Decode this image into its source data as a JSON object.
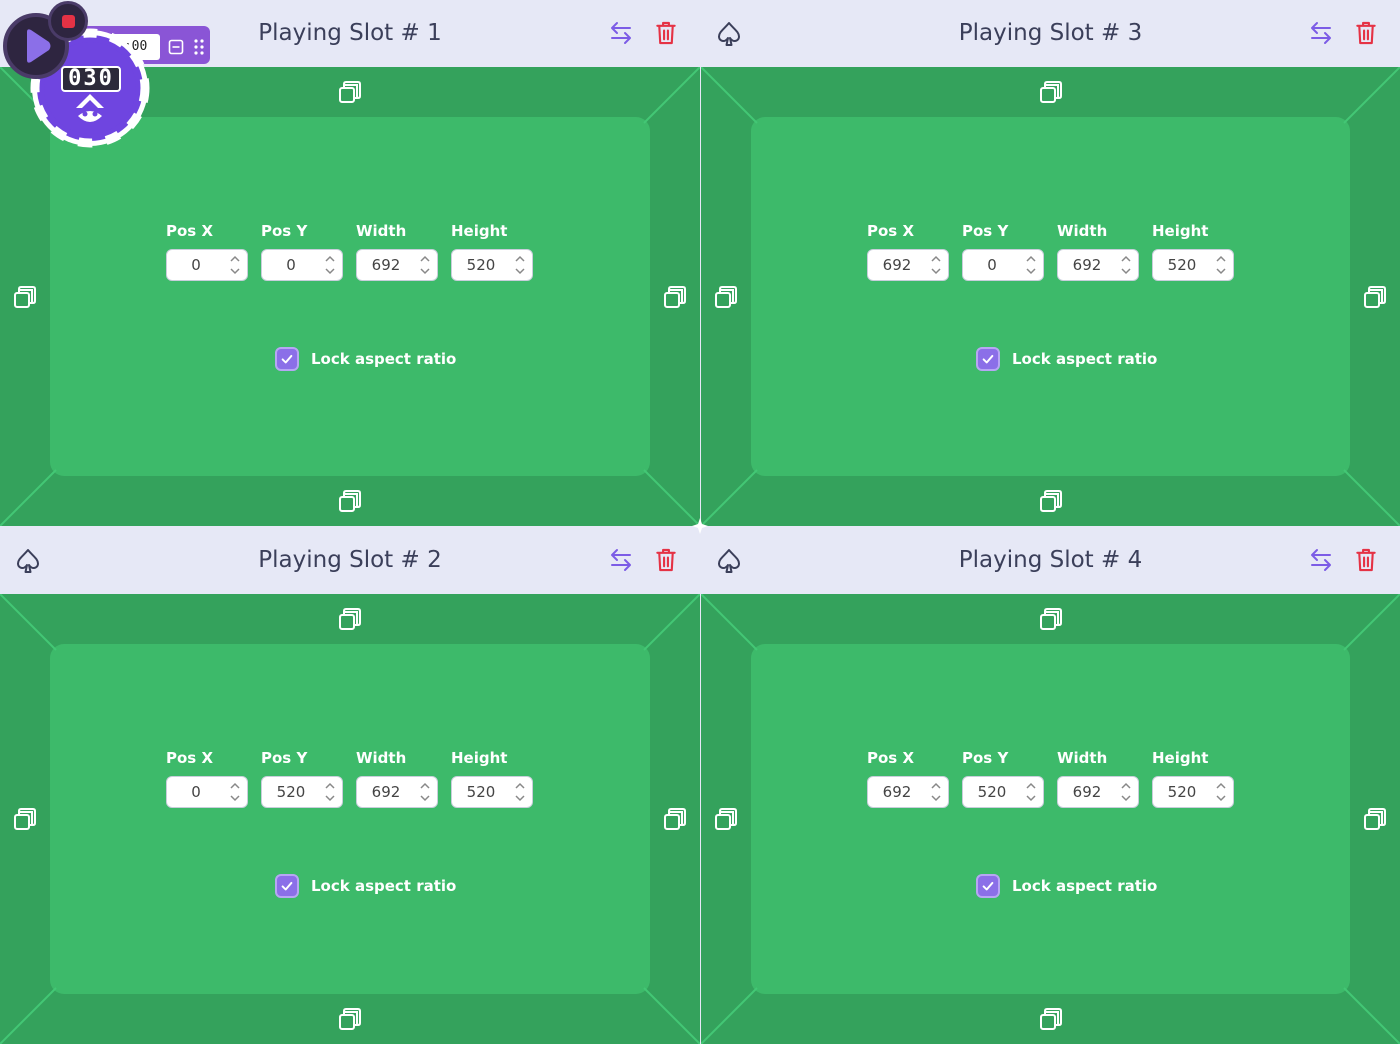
{
  "colors": {
    "header_bg": "#e6e8f6",
    "felt_main": "#3dba6a",
    "felt_rail": "#34a25c",
    "accent_purple": "#8b6fe8",
    "trash_red": "#e53245",
    "recorder_purple": "#8a55d6"
  },
  "recorder": {
    "time": "00:00:00",
    "count": "030",
    "icons": [
      "play-icon",
      "stop-icon",
      "minimize-icon",
      "drag-handle-icon",
      "poker-chip-icon"
    ]
  },
  "labels": {
    "pos_x": "Pos X",
    "pos_y": "Pos Y",
    "width": "Width",
    "height": "Height",
    "lock_aspect": "Lock aspect ratio"
  },
  "slots": [
    {
      "title": "Playing Slot # 1",
      "pos_x": "0",
      "pos_y": "0",
      "width": "692",
      "height": "520",
      "lock": true
    },
    {
      "title": "Playing Slot # 3",
      "pos_x": "692",
      "pos_y": "0",
      "width": "692",
      "height": "520",
      "lock": true
    },
    {
      "title": "Playing Slot # 2",
      "pos_x": "0",
      "pos_y": "520",
      "width": "692",
      "height": "520",
      "lock": true
    },
    {
      "title": "Playing Slot # 4",
      "pos_x": "692",
      "pos_y": "520",
      "width": "692",
      "height": "520",
      "lock": true
    }
  ]
}
